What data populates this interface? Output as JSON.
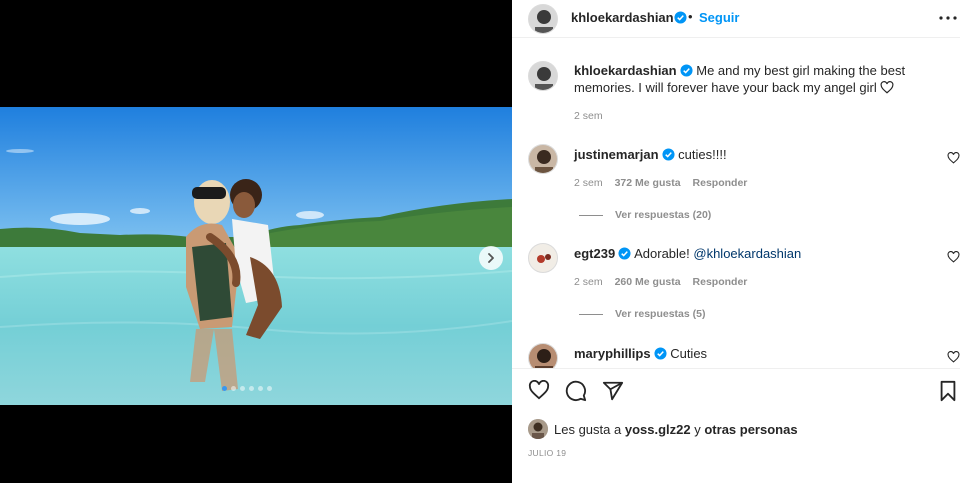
{
  "post": {
    "author": "khloekardashian",
    "follow_label": "Seguir",
    "caption": "Me and my best girl making the best memories. I will forever have your back my angel girl",
    "caption_time": "2 sem",
    "carousel": {
      "total": 6,
      "active_index": 0
    }
  },
  "comments": [
    {
      "user": "justinemarjan",
      "verified": true,
      "text": "cuties!!!!",
      "time": "2 sem",
      "likes": "372 Me gusta",
      "reply": "Responder",
      "view_replies": "Ver respuestas (20)"
    },
    {
      "user": "egt239",
      "verified": true,
      "text": "Adorable! ",
      "mention": "@khloekardashian",
      "time": "2 sem",
      "likes": "260 Me gusta",
      "reply": "Responder",
      "view_replies": "Ver respuestas (5)"
    },
    {
      "user": "maryphillips",
      "verified": true,
      "text": "Cuties"
    }
  ],
  "likes": {
    "prefix": "Les gusta a",
    "user": "yoss.glz22",
    "joiner": "y",
    "others": "otras personas"
  },
  "date": "JULIO 19",
  "icons": [
    "heart-icon",
    "comment-icon",
    "share-icon",
    "bookmark-icon",
    "more-icon",
    "verified-badge-icon",
    "chevron-right-icon"
  ],
  "colors": {
    "accent": "#0095f6",
    "verified": "#0095f6",
    "muted": "#8e8e8e",
    "text": "#262626",
    "sea": "#7fd3d9",
    "sky": "#2d8ee3"
  }
}
